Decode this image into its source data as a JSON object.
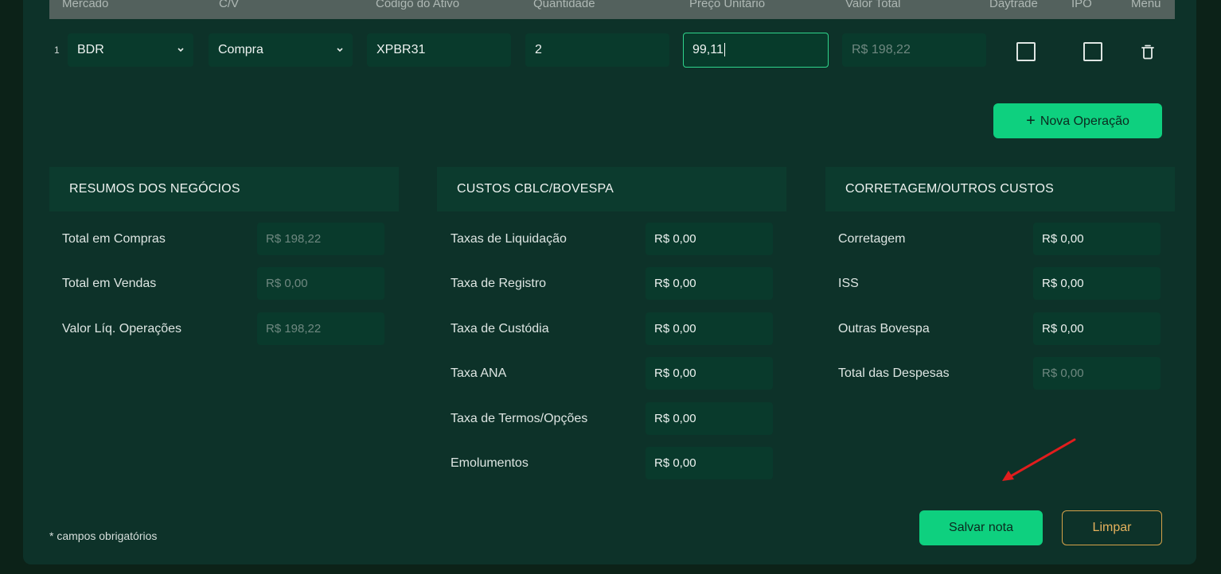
{
  "table": {
    "headers": [
      "Mercado",
      "C/V",
      "Código do Ativo",
      "Quantidade",
      "Preço Unitário",
      "Valor Total",
      "Daytrade",
      "IPO",
      "Menu"
    ],
    "row": {
      "index": "1",
      "mercado": "BDR",
      "cv": "Compra",
      "codigo": "XPBR31",
      "quantidade": "2",
      "preco": "99,11",
      "valor_total": "R$ 198,22"
    }
  },
  "actions": {
    "nova_operacao": "Nova Operação",
    "plus_icon": "+",
    "salvar": "Salvar nota",
    "limpar": "Limpar"
  },
  "sections": {
    "resumos": {
      "title": "RESUMOS DOS NEGÓCIOS",
      "items": [
        {
          "label": "Total em Compras",
          "value": "R$ 198,22"
        },
        {
          "label": "Total em Vendas",
          "value": "R$ 0,00"
        },
        {
          "label": "Valor Líq. Operações",
          "value": "R$ 198,22"
        }
      ]
    },
    "custos": {
      "title": "CUSTOS CBLC/BOVESPA",
      "items": [
        {
          "label": "Taxas de Liquidação",
          "value": "R$ 0,00"
        },
        {
          "label": "Taxa de Registro",
          "value": "R$ 0,00"
        },
        {
          "label": "Taxa de Custódia",
          "value": "R$ 0,00"
        },
        {
          "label": "Taxa ANA",
          "value": "R$ 0,00"
        },
        {
          "label": "Taxa de Termos/Opções",
          "value": "R$ 0,00"
        },
        {
          "label": "Emolumentos",
          "value": "R$ 0,00"
        }
      ]
    },
    "corretagem": {
      "title": "CORRETAGEM/OUTROS CUSTOS",
      "items": [
        {
          "label": "Corretagem",
          "value": "R$ 0,00"
        },
        {
          "label": "ISS",
          "value": "R$ 0,00"
        },
        {
          "label": "Outras Bovespa",
          "value": "R$ 0,00"
        },
        {
          "label": "Total das Despesas",
          "value": "R$ 0,00"
        }
      ]
    }
  },
  "footnote": "* campos obrigatórios",
  "colors": {
    "accent": "#0ed07f",
    "outline": "#d5a24a",
    "annotation_arrow": "#e11d1d"
  }
}
